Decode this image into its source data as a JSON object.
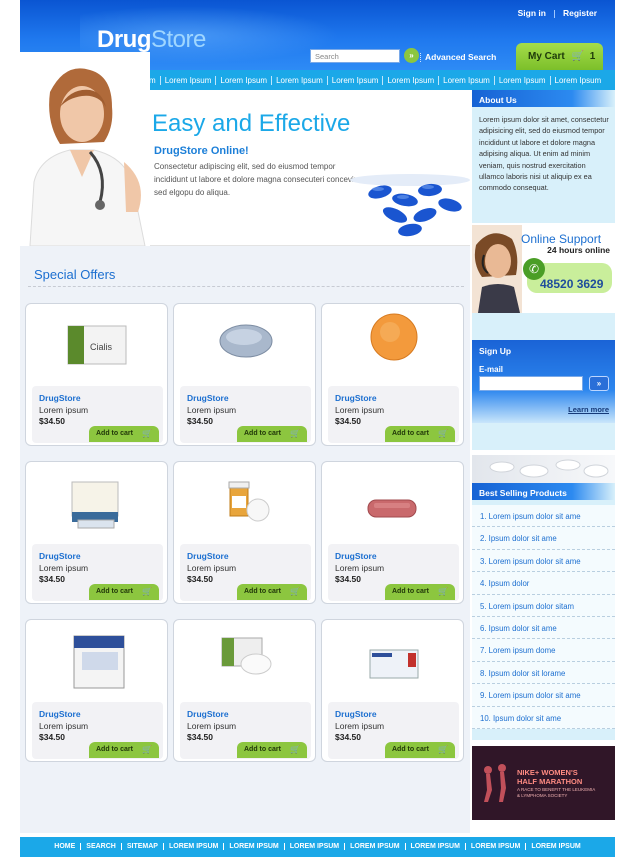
{
  "header": {
    "logo_part1": "Drug",
    "logo_part2": "Store",
    "signin": "Sign in",
    "register": "Register",
    "search_placeholder": "Search",
    "advanced_search": "Advanced Search",
    "cart_label": "My Cart",
    "cart_count": "1"
  },
  "nav": [
    "Lorem Ipsum",
    "Lorem Ipsum",
    "Lorem Ipsum",
    "Lorem Ipsum",
    "Lorem Ipsum",
    "Lorem Ipsum",
    "Lorem Ipsum",
    "Lorem Ipsum",
    "Lorem Ipsum"
  ],
  "hero": {
    "title": "Easy and Effective",
    "subtitle": "DrugStore Online!",
    "description": "Consectetur adipiscing elit, sed do eiusmod tempor incididunt ut labore et dolore magna consecuteri conceviruo sed elgopu do aliqua."
  },
  "special_offers_title": "Special Offers",
  "products": [
    {
      "brand": "DrugStore",
      "name": "Lorem ipsum",
      "price": "$34.50",
      "add": "Add to cart",
      "image": "cialis-box"
    },
    {
      "brand": "DrugStore",
      "name": "Lorem ipsum",
      "price": "$34.50",
      "add": "Add to cart",
      "image": "xanax-pill"
    },
    {
      "brand": "DrugStore",
      "name": "Lorem ipsum",
      "price": "$34.50",
      "add": "Add to cart",
      "image": "orange-pill"
    },
    {
      "brand": "DrugStore",
      "name": "Lorem ipsum",
      "price": "$34.50",
      "add": "Add to cart",
      "image": "pill-pack"
    },
    {
      "brand": "DrugStore",
      "name": "Lorem ipsum",
      "price": "$34.50",
      "add": "Add to cart",
      "image": "pill-bottle"
    },
    {
      "brand": "DrugStore",
      "name": "Lorem ipsum",
      "price": "$34.50",
      "add": "Add to cart",
      "image": "ambien-pill"
    },
    {
      "brand": "DrugStore",
      "name": "Lorem ipsum",
      "price": "$34.50",
      "add": "Add to cart",
      "image": "kamagra-box"
    },
    {
      "brand": "DrugStore",
      "name": "Lorem ipsum",
      "price": "$34.50",
      "add": "Add to cart",
      "image": "cialis-tablets"
    },
    {
      "brand": "DrugStore",
      "name": "Lorem ipsum",
      "price": "$34.50",
      "add": "Add to cart",
      "image": "kamagra-sachet"
    }
  ],
  "sidebar": {
    "about_title": "About Us",
    "about_text": "Lorem ipsum dolor sit amet, consectetur adipisicing elit, sed do eiusmod tempor incididunt ut labore et dolore magna adipising  aliqua. Ut enim ad minim veniam, quis nostrud exercitation ullamco laboris nisi ut aliquip ex ea commodo consequat.",
    "support_title": "Online Support",
    "support_hours": "24 hours online",
    "support_phone": "48520 3629",
    "signup_title": "Sign Up",
    "email_label": "E-mail",
    "learn_more": "Learn more",
    "best_title": "Best Selling Products",
    "best_items": [
      "1. Lorem ipsum dolor sit ame",
      "2. Ipsum dolor sit ame",
      "3. Lorem ipsum dolor sit ame",
      "4. Ipsum dolor",
      "5. Lorem ipsum dolor sitam",
      "6. Ipsum dolor sit ame",
      "7. Lorem ipsum dome",
      "8. Ipsum dolor sit lorame",
      "9. Lorem ipsum dolor sit ame",
      "10. Ipsum dolor sit ame"
    ],
    "banner_line1": "NIKE+ WOMEN'S",
    "banner_line2": "HALF MARATHON",
    "banner_small": "A RACE TO BENEFIT THE LEUKEMIA & LYMPHOMA SOCIETY"
  },
  "footer": [
    "HOME",
    "SEARCH",
    "SITEMAP",
    "LOREM IPSUM",
    "LOREM IPSUM",
    "LOREM IPSUM",
    "LOREM IPSUM",
    "LOREM IPSUM",
    "LOREM IPSUM",
    "LOREM IPSUM"
  ],
  "colors": {
    "brand_blue": "#1c6fd0",
    "nav_blue": "#1ba8e8",
    "accent_green": "#8cc63f"
  }
}
